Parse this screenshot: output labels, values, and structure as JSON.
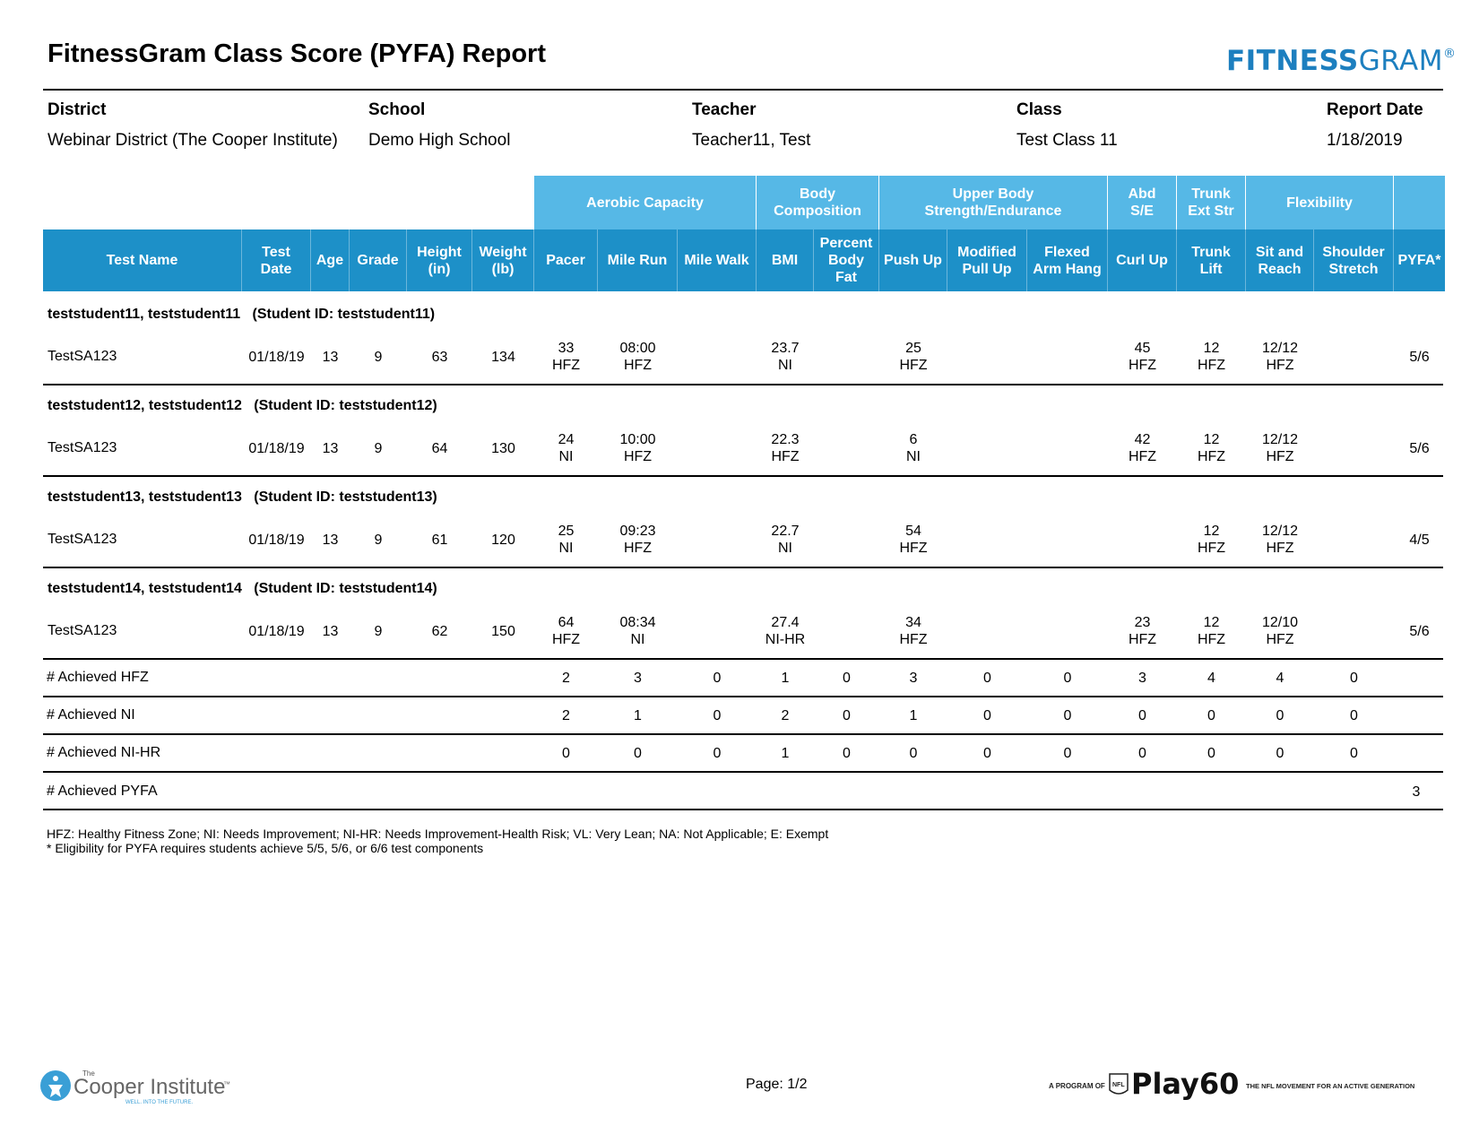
{
  "report": {
    "title": "FitnessGram Class Score (PYFA) Report",
    "brand_bold": "FITNESS",
    "brand_light": "GRAM",
    "brand_mark": "®"
  },
  "meta": {
    "district_label": "District",
    "district": "Webinar District (The Cooper Institute)",
    "school_label": "School",
    "school": "Demo High School",
    "teacher_label": "Teacher",
    "teacher": "Teacher11, Test",
    "class_label": "Class",
    "class": "Test Class 11",
    "report_date_label": "Report Date",
    "report_date": "1/18/2019"
  },
  "groups": {
    "aerobic": "Aerobic Capacity",
    "body_comp_1": "Body",
    "body_comp_2": "Composition",
    "upper_1": "Upper Body",
    "upper_2": "Strength/Endurance",
    "abd_1": "Abd",
    "abd_2": "S/E",
    "trunk_1": "Trunk",
    "trunk_2": "Ext Str",
    "flex": "Flexibility"
  },
  "columns": {
    "test_name": "Test Name",
    "test_date_1": "Test",
    "test_date_2": "Date",
    "age": "Age",
    "grade": "Grade",
    "height_1": "Height",
    "height_2": "(in)",
    "weight_1": "Weight",
    "weight_2": "(lb)",
    "pacer": "Pacer",
    "mile_run": "Mile Run",
    "mile_walk": "Mile Walk",
    "bmi": "BMI",
    "pbf_1": "Percent",
    "pbf_2": "Body",
    "pbf_3": "Fat",
    "push_up": "Push Up",
    "mod_1": "Modified",
    "mod_2": "Pull Up",
    "fah_1": "Flexed",
    "fah_2": "Arm Hang",
    "curl_up": "Curl Up",
    "trunk_1": "Trunk",
    "trunk_2": "Lift",
    "sit_1": "Sit and",
    "sit_2": "Reach",
    "sh_1": "Shoulder",
    "sh_2": "Stretch",
    "pyfa": "PYFA*"
  },
  "students": [
    {
      "header": "teststudent11, teststudent11   (Student ID: teststudent11)",
      "test_name": "TestSA123",
      "test_date": "01/18/19",
      "age": "13",
      "grade": "9",
      "height": "63",
      "weight": "134",
      "pacer": "33",
      "pacer_z": "HFZ",
      "mile_run": "08:00",
      "mile_run_z": "HFZ",
      "bmi": "23.7",
      "bmi_z": "NI",
      "push_up": "25",
      "push_up_z": "HFZ",
      "curl_up": "45",
      "curl_up_z": "HFZ",
      "trunk": "12",
      "trunk_z": "HFZ",
      "sit": "12/12",
      "sit_z": "HFZ",
      "pyfa": "5/6"
    },
    {
      "header": "teststudent12, teststudent12   (Student ID: teststudent12)",
      "test_name": "TestSA123",
      "test_date": "01/18/19",
      "age": "13",
      "grade": "9",
      "height": "64",
      "weight": "130",
      "pacer": "24",
      "pacer_z": "NI",
      "mile_run": "10:00",
      "mile_run_z": "HFZ",
      "bmi": "22.3",
      "bmi_z": "HFZ",
      "push_up": "6",
      "push_up_z": "NI",
      "curl_up": "42",
      "curl_up_z": "HFZ",
      "trunk": "12",
      "trunk_z": "HFZ",
      "sit": "12/12",
      "sit_z": "HFZ",
      "pyfa": "5/6"
    },
    {
      "header": "teststudent13, teststudent13   (Student ID: teststudent13)",
      "test_name": "TestSA123",
      "test_date": "01/18/19",
      "age": "13",
      "grade": "9",
      "height": "61",
      "weight": "120",
      "pacer": "25",
      "pacer_z": "NI",
      "mile_run": "09:23",
      "mile_run_z": "HFZ",
      "bmi": "22.7",
      "bmi_z": "NI",
      "push_up": "54",
      "push_up_z": "HFZ",
      "curl_up": "",
      "curl_up_z": "",
      "trunk": "12",
      "trunk_z": "HFZ",
      "sit": "12/12",
      "sit_z": "HFZ",
      "pyfa": "4/5"
    },
    {
      "header": "teststudent14, teststudent14   (Student ID: teststudent14)",
      "test_name": "TestSA123",
      "test_date": "01/18/19",
      "age": "13",
      "grade": "9",
      "height": "62",
      "weight": "150",
      "pacer": "64",
      "pacer_z": "HFZ",
      "mile_run": "08:34",
      "mile_run_z": "NI",
      "bmi": "27.4",
      "bmi_z": "NI-HR",
      "push_up": "34",
      "push_up_z": "HFZ",
      "curl_up": "23",
      "curl_up_z": "HFZ",
      "trunk": "12",
      "trunk_z": "HFZ",
      "sit": "12/10",
      "sit_z": "HFZ",
      "pyfa": "5/6"
    }
  ],
  "summary": {
    "hfz": {
      "label": "# Achieved HFZ",
      "values": [
        "2",
        "3",
        "0",
        "1",
        "0",
        "3",
        "0",
        "0",
        "3",
        "4",
        "4",
        "0"
      ]
    },
    "ni": {
      "label": "# Achieved NI",
      "values": [
        "2",
        "1",
        "0",
        "2",
        "0",
        "1",
        "0",
        "0",
        "0",
        "0",
        "0",
        "0"
      ]
    },
    "nihr": {
      "label": "# Achieved NI-HR",
      "values": [
        "0",
        "0",
        "0",
        "1",
        "0",
        "0",
        "0",
        "0",
        "0",
        "0",
        "0",
        "0"
      ]
    },
    "pyfa": {
      "label": "# Achieved PYFA",
      "value": "3"
    }
  },
  "legend": {
    "line1": "HFZ: Healthy Fitness Zone; NI: Needs Improvement; NI-HR: Needs Improvement-Health Risk; VL: Very Lean; NA: Not Applicable; E: Exempt",
    "line2": "* Eligibility for PYFA requires students achieve 5/5, 5/6, or 6/6 test components"
  },
  "footer": {
    "cooper_the": "The",
    "cooper_name": "Cooper Institute",
    "cooper_tm": "™",
    "cooper_tag": "WELL. INTO THE FUTURE.",
    "page": "Page: 1/2",
    "play_prefix": "A PROGRAM OF",
    "play_nfl": "NFL",
    "play_name": "Play60",
    "play_suffix": "THE NFL MOVEMENT FOR AN ACTIVE GENERATION"
  },
  "colors": {
    "group_header": "#56b8e6",
    "column_header": "#1d90c8",
    "brand": "#1d7fbf"
  }
}
